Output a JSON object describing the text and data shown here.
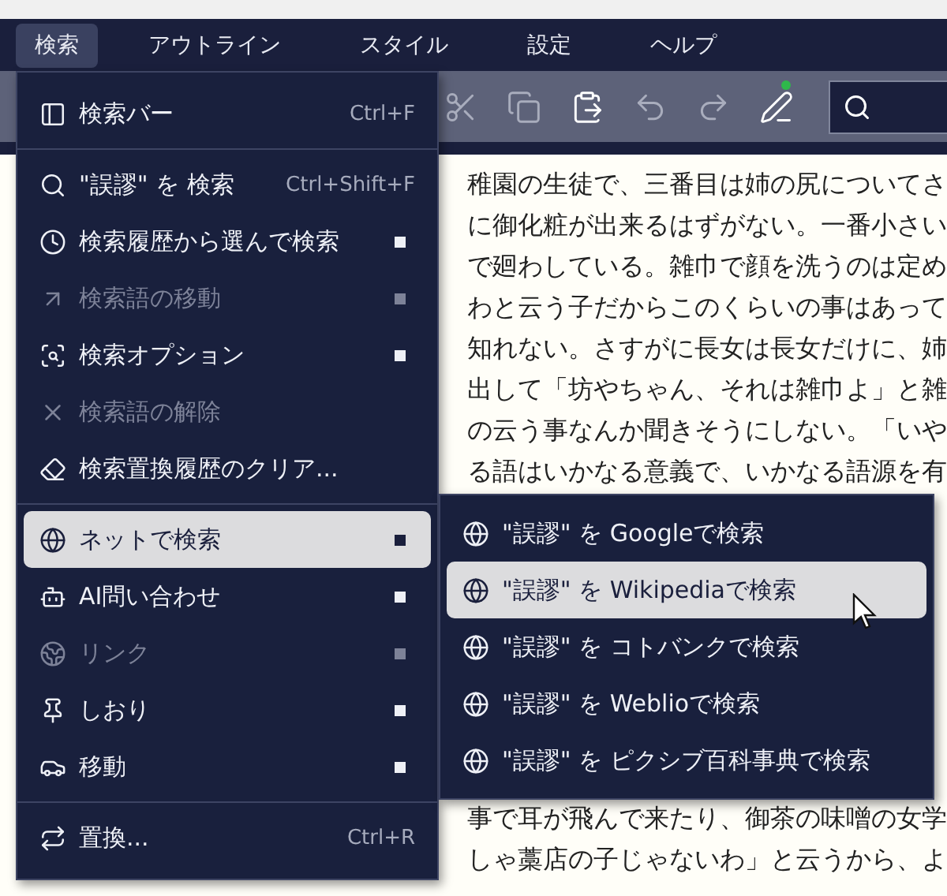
{
  "menubar": [
    {
      "label": "検索",
      "selected": true
    },
    {
      "label": "アウトライン",
      "selected": false
    },
    {
      "label": "スタイル",
      "selected": false
    },
    {
      "label": "設定",
      "selected": false
    },
    {
      "label": "ヘルプ",
      "selected": false
    }
  ],
  "toolbar": {
    "buttons": [
      {
        "disabled": true
      },
      {
        "disabled": true
      },
      {
        "disabled": false
      },
      {
        "disabled": true
      },
      {
        "disabled": true
      },
      {
        "disabled": false
      }
    ]
  },
  "document": {
    "upper_lines": [
      "稚園の生徒で、三番目は姉の尻についてさ",
      "に御化粧が出来るはずがない。一番小さい",
      "で廻わしている。雑巾で顔を洗うのは定め",
      "わと云う子だからこのくらいの事はあって",
      "知れない。さすがに長女は長女だけに、姉",
      "出して「坊やちゃん、それは雑巾よ」と雑",
      "の云う事なんか聞きそうにしない。「いや",
      "る語はいかなる意義で、いかなる語源を有"
    ],
    "lower_lines": [
      "事で耳が飛んで来たり、御茶の味噌の女学",
      "しゃ藁店の子じゃないわ」と云うから、よ"
    ]
  },
  "menu": {
    "items": [
      {
        "kind": "item",
        "label": "検索バー",
        "shortcut": "Ctrl+F",
        "disabled": false,
        "submenu": false,
        "selected": false
      },
      {
        "kind": "separator"
      },
      {
        "kind": "item",
        "label": "\"誤謬\" を 検索",
        "shortcut": "Ctrl+Shift+F",
        "disabled": false,
        "submenu": false,
        "selected": false
      },
      {
        "kind": "item",
        "label": "検索履歴から選んで検索",
        "disabled": false,
        "submenu": true,
        "selected": false
      },
      {
        "kind": "item",
        "label": "検索語の移動",
        "disabled": true,
        "submenu": true,
        "selected": false
      },
      {
        "kind": "item",
        "label": "検索オプション",
        "disabled": false,
        "submenu": true,
        "selected": false
      },
      {
        "kind": "item",
        "label": "検索語の解除",
        "disabled": true,
        "submenu": false,
        "selected": false
      },
      {
        "kind": "item",
        "label": "検索置換履歴のクリア...",
        "disabled": false,
        "submenu": false,
        "selected": false
      },
      {
        "kind": "separator"
      },
      {
        "kind": "item",
        "label": "ネットで検索",
        "disabled": false,
        "submenu": true,
        "selected": true
      },
      {
        "kind": "item",
        "label": "AI問い合わせ",
        "disabled": false,
        "submenu": true,
        "selected": false
      },
      {
        "kind": "item",
        "label": "リンク",
        "disabled": true,
        "submenu": true,
        "selected": false
      },
      {
        "kind": "item",
        "label": "しおり",
        "disabled": false,
        "submenu": true,
        "selected": false
      },
      {
        "kind": "item",
        "label": "移動",
        "disabled": false,
        "submenu": true,
        "selected": false
      },
      {
        "kind": "separator"
      },
      {
        "kind": "item",
        "label": "置換...",
        "shortcut": "Ctrl+R",
        "disabled": false,
        "submenu": false,
        "selected": false
      }
    ]
  },
  "submenu": {
    "items": [
      {
        "label": "\"誤謬\" を Googleで検索",
        "selected": false
      },
      {
        "label": "\"誤謬\" を Wikipediaで検索",
        "selected": true
      },
      {
        "label": "\"誤謬\" を コトバンクで検索",
        "selected": false
      },
      {
        "label": "\"誤謬\" を Weblioで検索",
        "selected": false
      },
      {
        "label": "\"誤謬\" を ピクシブ百科事典で検索",
        "selected": false
      }
    ]
  }
}
